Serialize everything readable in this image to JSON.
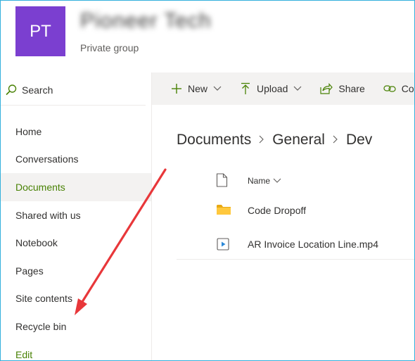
{
  "header": {
    "avatar_initials": "PT",
    "site_name": "Pioneer Tech",
    "site_type": "Private group"
  },
  "search": {
    "label": "Search"
  },
  "nav": {
    "items": [
      "Home",
      "Conversations",
      "Documents",
      "Shared with us",
      "Notebook",
      "Pages",
      "Site contents",
      "Recycle bin"
    ],
    "selected": "Documents",
    "edit": "Edit"
  },
  "commands": {
    "new": "New",
    "upload": "Upload",
    "share": "Share",
    "copy_link": "Copy link"
  },
  "breadcrumb": [
    "Documents",
    "General",
    "Dev"
  ],
  "list": {
    "column_name": "Name",
    "files": [
      {
        "name": "Code Dropoff",
        "type": "folder"
      },
      {
        "name": "AR Invoice Location Line.mp4",
        "type": "video"
      }
    ]
  },
  "colors": {
    "avatar": "#7b3fd0",
    "accent_green": "#498205",
    "arrow": "#e8373a",
    "frame_border": "#33b0dc"
  }
}
